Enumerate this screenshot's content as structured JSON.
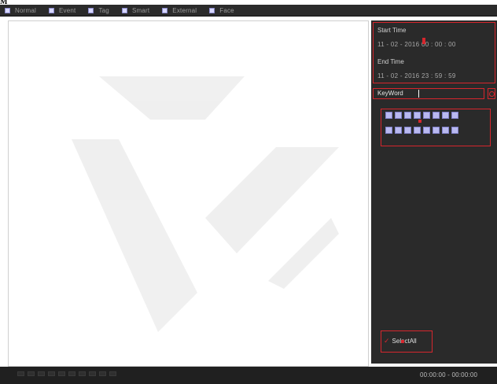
{
  "top_fragment": "M",
  "tabs": [
    {
      "label": "Normal"
    },
    {
      "label": "Event"
    },
    {
      "label": "Tag"
    },
    {
      "label": "Smart"
    },
    {
      "label": "External"
    },
    {
      "label": "Face"
    }
  ],
  "right_panel": {
    "start_time_label": "Start Time",
    "start_time_value": "11 - 02 - 2016   00 : 00 : 00",
    "end_time_label": "End Time",
    "end_time_value": "11 - 02 - 2016   23 : 59 : 59",
    "keyword_label": "KeyWord",
    "keyword_value": "",
    "select_all_label": "SelectAll",
    "select_all_checked": true
  },
  "bottom_bar": {
    "time_range": "00:00:00  -  00:00:00"
  },
  "colors": {
    "highlight": "#d6262d",
    "panel_bg": "#2a2a2a",
    "tab_bar_bg": "#2b2b2b",
    "bottom_bar_bg": "#202020"
  }
}
